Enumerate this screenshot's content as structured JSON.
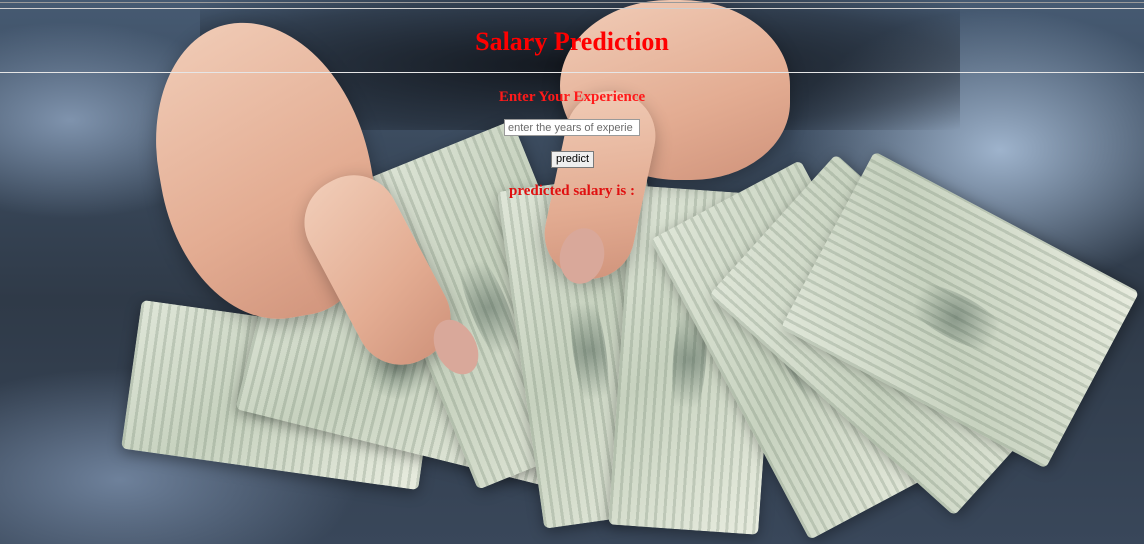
{
  "page": {
    "title": "Salary Prediction"
  },
  "form": {
    "experience_label": "Enter Your Experience",
    "experience_input": {
      "value": "",
      "placeholder": "enter the years of experie"
    },
    "predict_button_label": "predict"
  },
  "result": {
    "text": "predicted salary is :"
  },
  "background": {
    "description_icon": "money-photo",
    "accent_color": "#ff0000"
  }
}
